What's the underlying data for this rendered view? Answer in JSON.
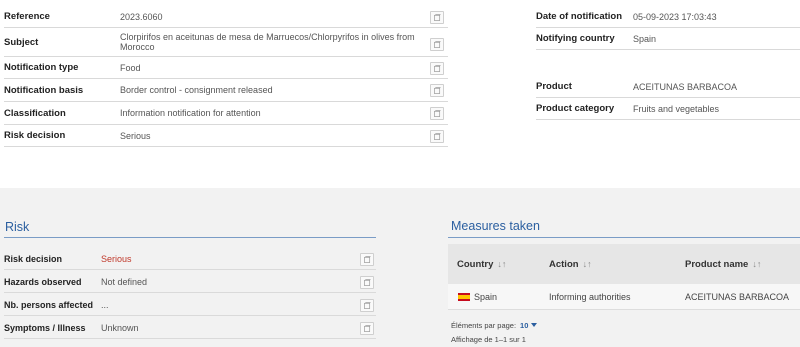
{
  "details_left": [
    {
      "label": "Reference",
      "value": "2023.6060"
    },
    {
      "label": "Subject",
      "value": "Clorpirifos en aceitunas de mesa de Marruecos/Chlorpyrifos in olives from Morocco"
    },
    {
      "label": "Notification type",
      "value": "Food"
    },
    {
      "label": "Notification basis",
      "value": "Border control - consignment released"
    },
    {
      "label": "Classification",
      "value": "Information notification for attention"
    },
    {
      "label": "Risk decision",
      "value": "Serious"
    }
  ],
  "details_right": [
    {
      "label": "Date of notification",
      "value": "05-09-2023 17:03:43"
    },
    {
      "label": "Notifying country",
      "value": "Spain"
    },
    {
      "label": "Product",
      "value": "ACEITUNAS BARBACOA"
    },
    {
      "label": "Product category",
      "value": "Fruits and vegetables"
    }
  ],
  "risk": {
    "title": "Risk",
    "rows": [
      {
        "label": "Risk decision",
        "value": "Serious"
      },
      {
        "label": "Hazards observed",
        "value": "Not defined"
      },
      {
        "label": "Nb. persons affected",
        "value": "..."
      },
      {
        "label": "Symptoms / Illness",
        "value": "Unknown"
      }
    ]
  },
  "measures": {
    "title": "Measures taken",
    "columns": [
      "Country",
      "Action",
      "Product name"
    ],
    "sort_icon": "↓↑",
    "rows": [
      {
        "country": "Spain",
        "action": "Informing authorities",
        "product": "ACEITUNAS BARBACOA"
      }
    ],
    "per_page_label": "Éléments par page:",
    "per_page_value": "10",
    "paging_info": "Affichage de 1–1 sur 1"
  },
  "colors": {
    "accent": "#2b5fa0",
    "serious": "#c0392b",
    "panel_bg": "#f2f2f2"
  },
  "icons": {
    "copy": "copy-icon",
    "flag": "spain-flag-icon",
    "sort": "sort-icon",
    "caret": "caret-down-icon"
  }
}
